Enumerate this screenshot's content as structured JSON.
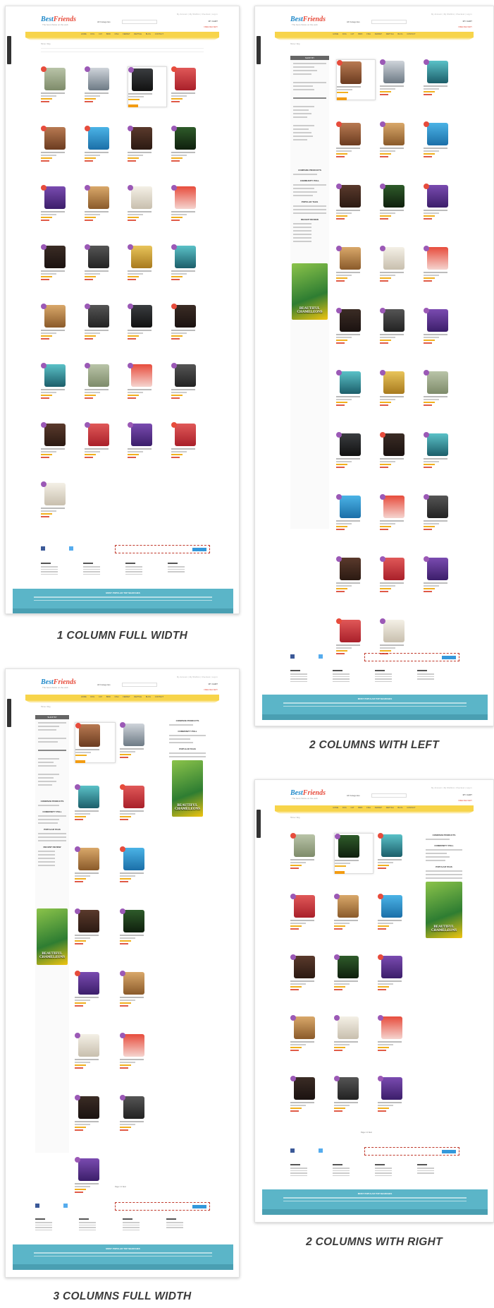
{
  "site": {
    "logo_part1": "Best",
    "logo_part2": "Friends",
    "tagline": "The best choice on the web",
    "top_links": "My Account | My Wishlist | Checkout | Log in",
    "category_select": "All Categories",
    "cart": "MY CART",
    "shipping": "FREE DELIVERY",
    "nav_items": "HOME DOG CAT BIRD FISH FERRET REPTILE BLOG CONTACT",
    "breadcrumb": "Home / Dog",
    "popular_title": "MOST POPULAR TOP SEARCHES",
    "ad_text": "BEAUTIFUL CHAMELEONS",
    "compare_title": "COMPARE PRODUCTS",
    "poll_title": "COMMUNITY POLL",
    "tags_title": "POPULAR TAGS",
    "review_title": "RECENT REVIEW",
    "shop_by": "SHOP BY",
    "pager": "Page 1 2 Next"
  },
  "captions": {
    "one_column": "1 COLUMN FULL WIDTH",
    "two_left": "2 COLUMNS WITH LEFT",
    "three_columns": "3 COLUMNS FULL WIDTH",
    "two_right": "2 COLUMNS WITH RIGHT"
  },
  "colors": {
    "nav_yellow": "#f7d44a",
    "popular_blue": "#5bb5c8",
    "badge_new": "#9b59b6",
    "badge_sale": "#e74c3c"
  }
}
